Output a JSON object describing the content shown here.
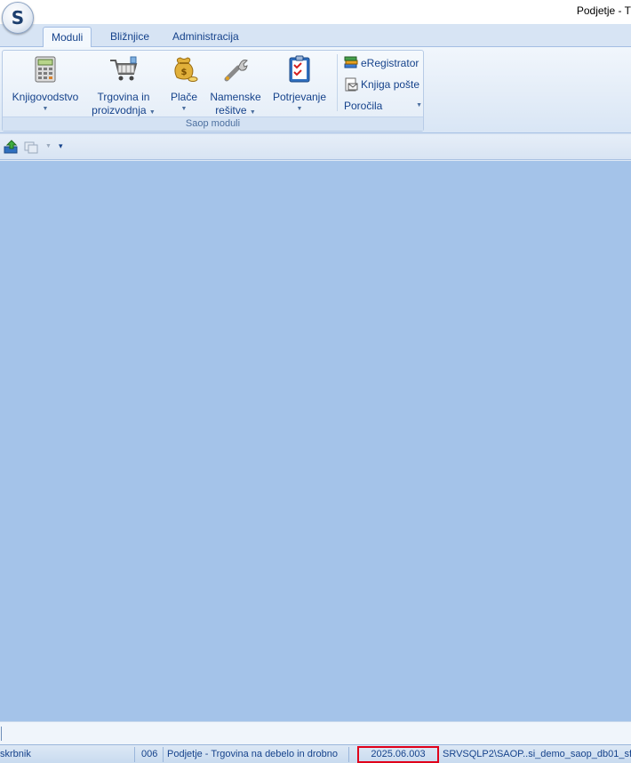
{
  "window": {
    "title": "Podjetje - T"
  },
  "app_button": {
    "glyph": "S"
  },
  "tabs": [
    {
      "label": "Moduli",
      "active": true
    },
    {
      "label": "Bližnjice",
      "active": false
    },
    {
      "label": "Administracija",
      "active": false
    }
  ],
  "ribbon": {
    "group_caption": "Saop moduli",
    "big_buttons": [
      {
        "line1": "Knjigovodstvo",
        "line2": "",
        "icon": "calculator-icon"
      },
      {
        "line1": "Trgovina in",
        "line2": "proizvodnja",
        "icon": "shopping-cart-icon"
      },
      {
        "line1": "Plače",
        "line2": "",
        "icon": "money-bag-icon"
      },
      {
        "line1": "Namenske",
        "line2": "rešitve",
        "icon": "wrench-icon"
      },
      {
        "line1": "Potrjevanje",
        "line2": "",
        "icon": "checklist-icon"
      }
    ],
    "small_buttons": [
      {
        "label": "eRegistrator",
        "icon": "books-icon"
      },
      {
        "label": "Knjiga pošte",
        "icon": "mail-book-icon"
      },
      {
        "label": "Poročila",
        "icon": ""
      }
    ]
  },
  "colors": {
    "workspace": "#a4c3e9",
    "highlight": "#e0001a",
    "text": "#15428b"
  },
  "statusbar": {
    "user": "skrbnik",
    "company_code": "006",
    "company_name": "Podjetje - Trgovina na debelo in drobno",
    "version": "2025.06.003",
    "database": "SRVSQLP2\\SAOP..si_demo_saop_db01_sf"
  }
}
